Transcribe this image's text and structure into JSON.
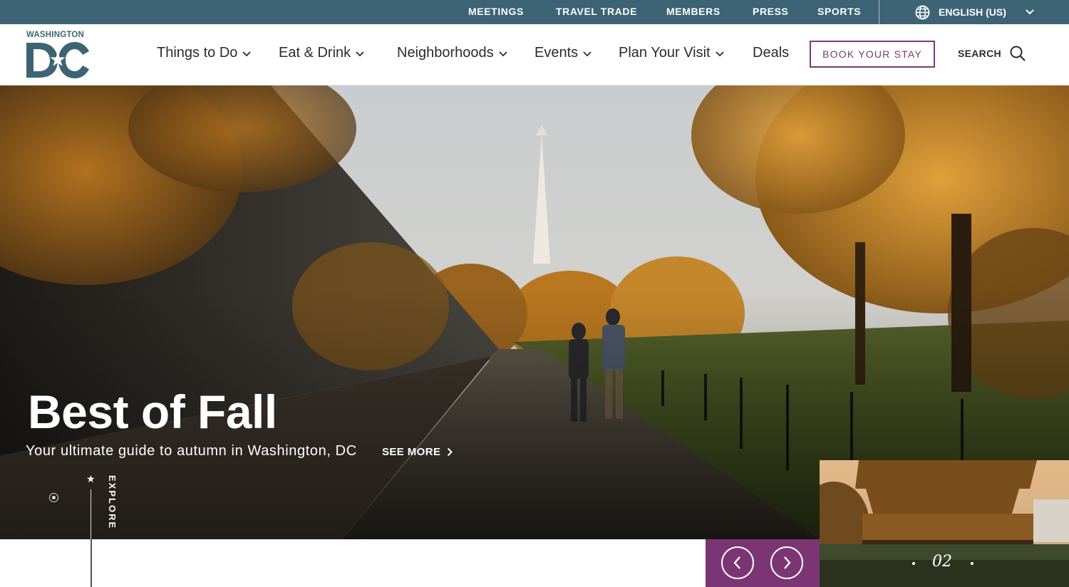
{
  "colors": {
    "topbar_bg": "#3d6474",
    "accent_purple": "#7b3574",
    "book_border": "#7a3a72",
    "logo_teal": "#3d6474"
  },
  "topbar": {
    "links": [
      "MEETINGS",
      "TRAVEL TRADE",
      "MEMBERS",
      "PRESS",
      "SPORTS"
    ],
    "language": "ENGLISH (US)",
    "language_icon": "globe-icon"
  },
  "logo": {
    "top_text": "WASHINGTON",
    "letters": "DC"
  },
  "nav": {
    "items": [
      {
        "label": "Things to Do",
        "has_dropdown": true
      },
      {
        "label": "Eat & Drink",
        "has_dropdown": true
      },
      {
        "label": "Neighborhoods",
        "has_dropdown": true
      },
      {
        "label": "Events",
        "has_dropdown": true
      },
      {
        "label": "Plan Your Visit",
        "has_dropdown": true
      },
      {
        "label": "Deals",
        "has_dropdown": false
      }
    ],
    "book_label": "BOOK YOUR STAY",
    "search_label": "SEARCH",
    "search_icon": "search-icon"
  },
  "hero": {
    "title": "Best of Fall",
    "subtitle": "Your ultimate guide to autumn in Washington, DC",
    "cta": "SEE MORE",
    "explore_label": "EXPLORE"
  },
  "carousel": {
    "counter": "02",
    "prev_icon": "chevron-left-icon",
    "next_icon": "chevron-right-icon"
  }
}
